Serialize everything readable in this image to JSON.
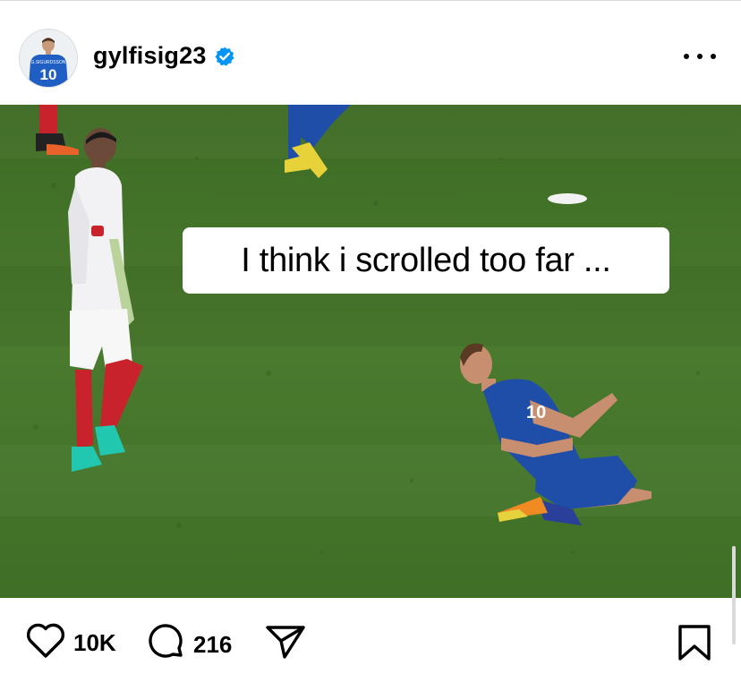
{
  "post": {
    "username": "gylfisig23",
    "verified": true,
    "avatar": {
      "jersey_name": "G.SIGURDSSON",
      "jersey_number": "10"
    },
    "image_caption": "I think i scrolled too far ...",
    "kneeling_player_number": "10",
    "likes": "10K",
    "comments": "216"
  },
  "icons": {
    "verified": "verified-badge-icon",
    "more": "more-options-icon",
    "like": "heart-icon",
    "comment": "comment-icon",
    "share": "share-icon",
    "save": "bookmark-icon"
  },
  "colors": {
    "verified_blue": "#0095f6",
    "pitch_green": "#4a7a2e",
    "iceland_blue": "#1f4ea8",
    "england_red": "#c8232c"
  }
}
